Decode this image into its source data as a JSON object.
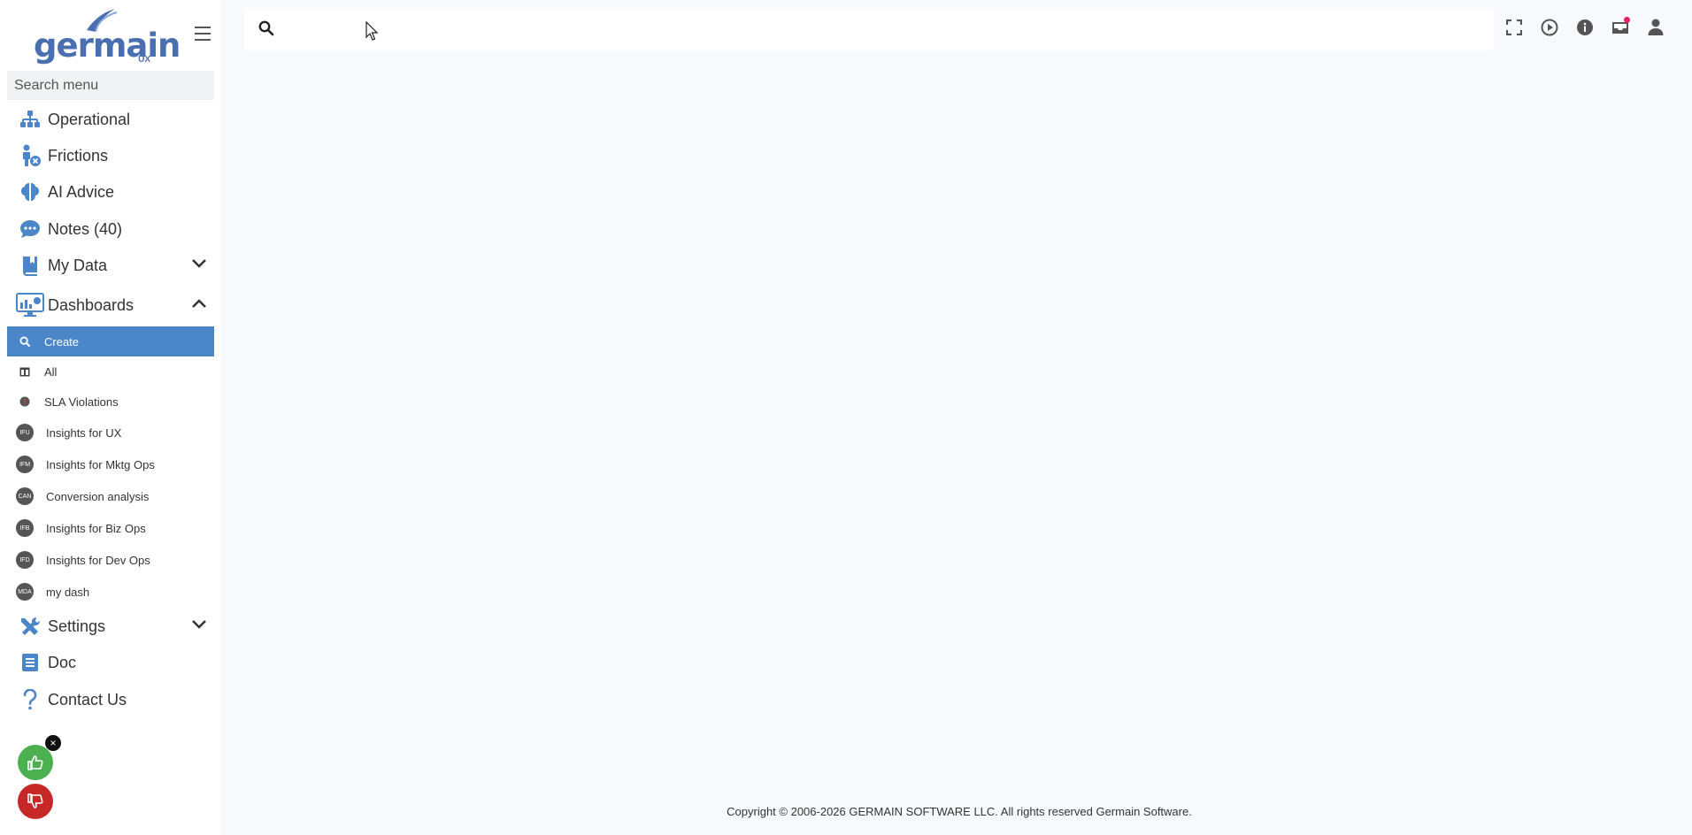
{
  "logo": {
    "text": "germain",
    "sub": "UX"
  },
  "sidebar": {
    "search_placeholder": "Search menu",
    "items": [
      {
        "label": "Operational",
        "icon": "sitemap-icon"
      },
      {
        "label": "Frictions",
        "icon": "person-x-icon"
      },
      {
        "label": "AI Advice",
        "icon": "brain-icon"
      },
      {
        "label": "Notes (40)",
        "icon": "comment-dots-icon"
      },
      {
        "label": "My Data",
        "icon": "book-bookmark-icon"
      },
      {
        "label": "Dashboards",
        "icon": "monitor-chart-icon"
      },
      {
        "label": "Settings",
        "icon": "tools-icon"
      },
      {
        "label": "Doc",
        "icon": "document-icon"
      },
      {
        "label": "Contact Us",
        "icon": "question-icon"
      }
    ],
    "dashboards_sub": [
      {
        "label": "Create",
        "badge": ""
      },
      {
        "label": "All",
        "badge": ""
      },
      {
        "label": "SLA Violations",
        "badge": ""
      },
      {
        "label": "Insights for UX",
        "badge": "IFU"
      },
      {
        "label": "Insights for Mktg Ops",
        "badge": "IFM"
      },
      {
        "label": "Conversion analysis",
        "badge": "CAN"
      },
      {
        "label": "Insights for Biz Ops",
        "badge": "IFB"
      },
      {
        "label": "Insights for Dev Ops",
        "badge": "IFD"
      },
      {
        "label": "my dash",
        "badge": "MDA"
      }
    ]
  },
  "feedback": {
    "close": "×"
  },
  "footer": {
    "copyright": "Copyright © 2006-2026 GERMAIN SOFTWARE LLC. All rights reserved Germain Software."
  },
  "colors": {
    "accent": "#4a86c8",
    "brand": "#4a6fb0",
    "thumb_up": "#4caf50",
    "thumb_down": "#c62828",
    "notification": "#e91e63"
  }
}
